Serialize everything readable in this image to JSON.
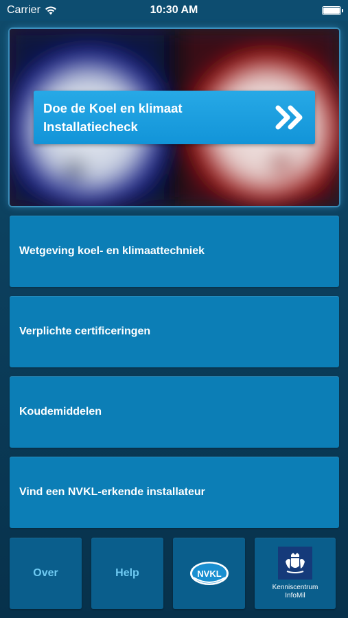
{
  "status_bar": {
    "carrier": "Carrier",
    "time": "10:30 AM",
    "icons": [
      "wifi-icon",
      "battery-icon"
    ]
  },
  "hero": {
    "title_line1": "Doe de Koel en klimaat",
    "title_line2": "Installatiecheck",
    "icon": "double-chevron-right-icon"
  },
  "menu": {
    "items": [
      {
        "label": "Wetgeving koel- en klimaattechniek"
      },
      {
        "label": "Verplichte certificeringen"
      },
      {
        "label": "Koudemiddelen"
      },
      {
        "label": "Vind een NVKL-erkende installateur"
      }
    ]
  },
  "bottom_bar": {
    "over": "Over",
    "help": "Help",
    "nvkl_logo_text": "NVKL",
    "kenniscentrum_line1": "Kenniscentrum",
    "kenniscentrum_line2": "InfoMil"
  },
  "colors": {
    "background": "#0b3c59",
    "menu_button": "#0c7eb6",
    "tile": "#0a5e8c",
    "banner": "#1a9ddd",
    "tile_text": "#6fcaf2"
  }
}
